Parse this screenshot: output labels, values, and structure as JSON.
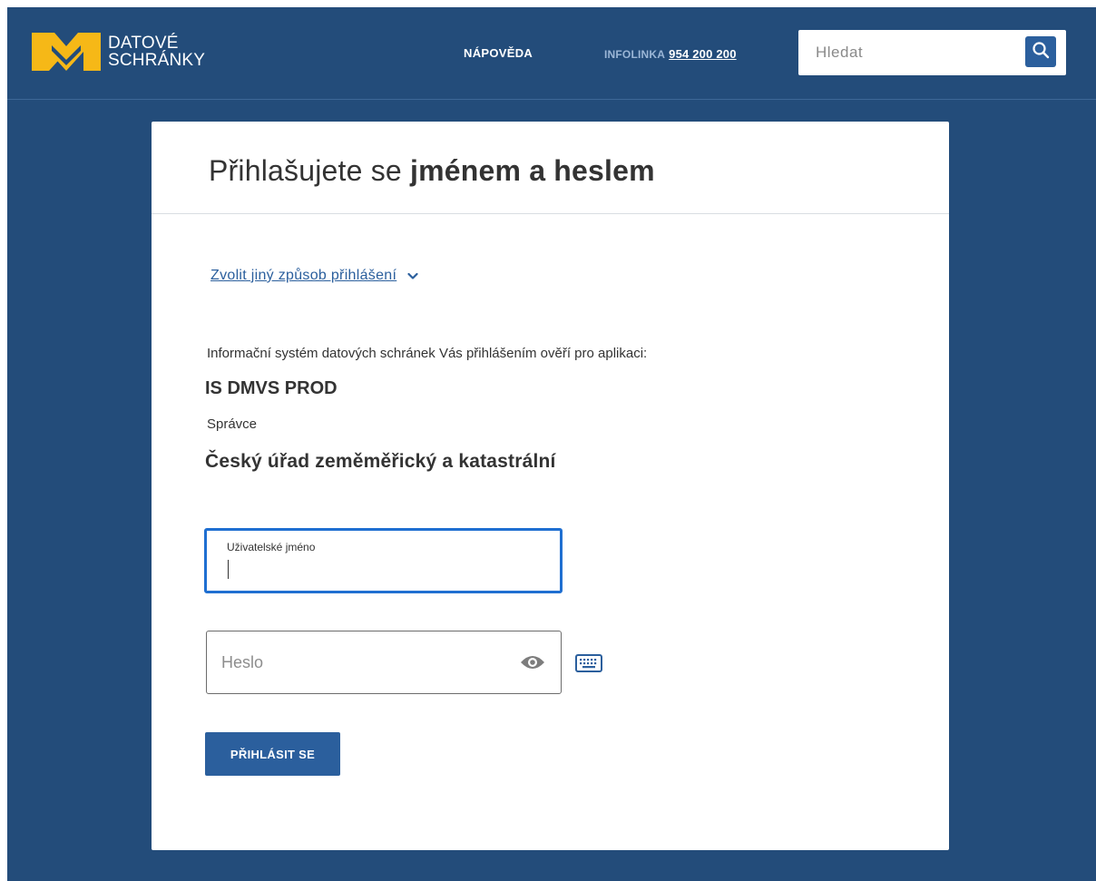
{
  "header": {
    "logo_line1": "DATOVÉ",
    "logo_line2": "SCHRÁNKY",
    "help_label": "NÁPOVĚDA",
    "infoline_label": "INFOLINKA",
    "infoline_number": "954 200 200",
    "search_placeholder": "Hledat",
    "search_icon": "search-icon"
  },
  "card": {
    "title_prefix": "Přihlašujete se ",
    "title_bold": "jménem a heslem",
    "other_method_link": "Zvolit jiný způsob přihlášení",
    "info_text": "Informační systém datových schránek Vás přihlášením ověří pro aplikaci:",
    "app_name": "IS DMVS PROD",
    "admin_label": "Správce",
    "admin_name": "Český úřad zeměměřický a katastrální"
  },
  "form": {
    "username_label": "Uživatelské jméno",
    "username_value": "",
    "password_placeholder": "Heslo",
    "password_value": "",
    "submit_label": "PŘIHLÁSIT SE"
  },
  "icons": {
    "logo": "datove-schranky-logo-icon",
    "chevron": "chevron-down-icon",
    "eye": "eye-icon",
    "keyboard": "keyboard-icon"
  },
  "colors": {
    "background": "#234c7a",
    "accent_blue": "#2b5f9d",
    "focus_blue": "#1f6fd1",
    "logo_yellow": "#f6b817"
  }
}
